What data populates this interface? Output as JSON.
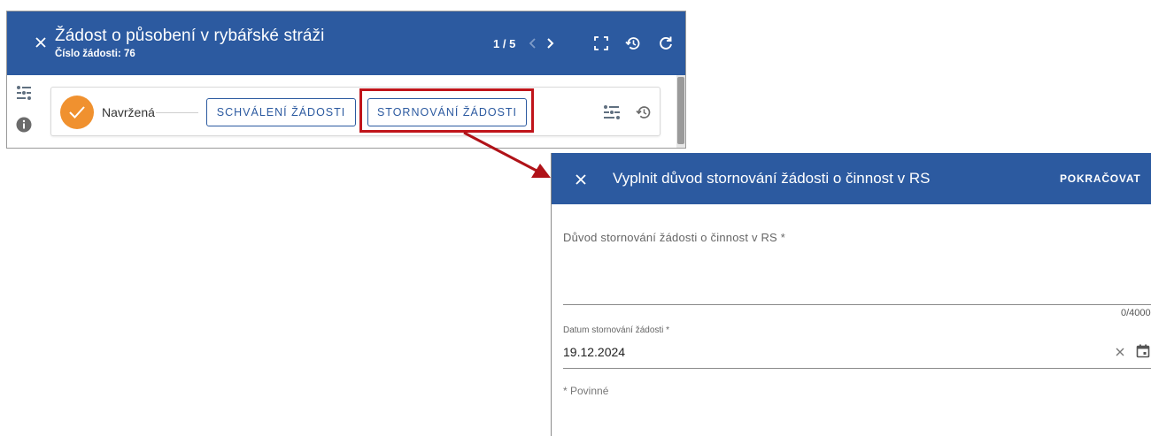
{
  "window": {
    "title": "Žádost o působení v rybářské stráži",
    "subtitle": "Číslo žádosti: 76",
    "pager": "1 / 5",
    "header_icons": [
      "close-icon",
      "chevron-left-icon",
      "chevron-right-icon",
      "fullscreen-icon",
      "history-icon",
      "refresh-icon"
    ],
    "side_icons": [
      "workflow-icon",
      "info-icon"
    ]
  },
  "workflow": {
    "current_state": "Navržená",
    "actions": [
      {
        "label": "SCHVÁLENÍ ŽÁDOSTI"
      },
      {
        "label": "STORNOVÁNÍ ŽÁDOSTI"
      }
    ],
    "icons": [
      "workflow-icon",
      "history-icon"
    ]
  },
  "dialog": {
    "title": "Vyplnit důvod stornování žádosti o činnost v RS",
    "continue_label": "POKRAČOVAT",
    "reason": {
      "label": "Důvod stornování žádosti o činnost v RS *",
      "value": "",
      "counter": "0/4000"
    },
    "date": {
      "label": "Datum stornování žádosti *",
      "value": "19.12.2024"
    },
    "required_note": "* Povinné"
  },
  "colors": {
    "primary": "#2c5aa0",
    "state_orange": "#f0912f",
    "highlight_red": "#c0141a"
  }
}
